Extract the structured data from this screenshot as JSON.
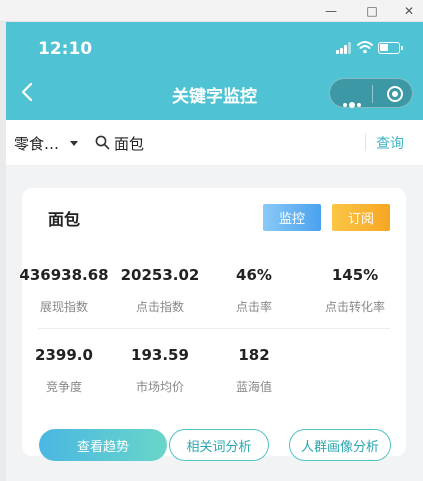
{
  "window": {
    "minimize_glyph": "—",
    "maximize_glyph": "□",
    "close_glyph": "✕"
  },
  "status": {
    "time": "12:10"
  },
  "nav": {
    "title": "关键字监控"
  },
  "search": {
    "category": "零食…",
    "query": "面包",
    "button": "查询"
  },
  "card": {
    "title": "面包",
    "monitor_label": "监控",
    "subscribe_label": "订阅",
    "stats": [
      {
        "value": "436938.68",
        "label": "展现指数"
      },
      {
        "value": "20253.02",
        "label": "点击指数"
      },
      {
        "value": "46%",
        "label": "点击率"
      },
      {
        "value": "145%",
        "label": "点击转化率"
      },
      {
        "value": "2399.0",
        "label": "竞争度"
      },
      {
        "value": "193.59",
        "label": "市场均价"
      },
      {
        "value": "182",
        "label": "蓝海值"
      }
    ],
    "actions": [
      "查看趋势",
      "相关词分析",
      "人群画像分析"
    ]
  },
  "colors": {
    "header": "#4fc3d4",
    "accent": "#3db6c6",
    "monitor": "#4aa2ee",
    "subscribe": "#f6a623"
  }
}
